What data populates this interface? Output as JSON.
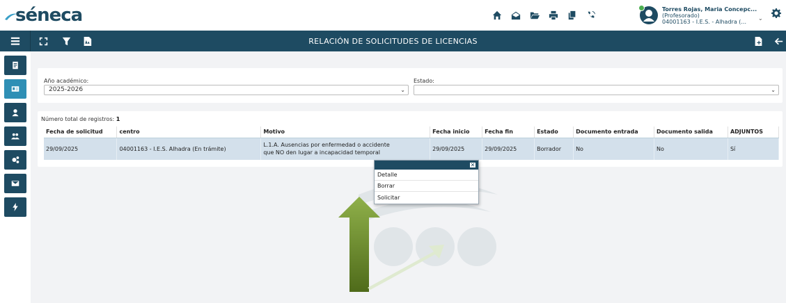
{
  "app": {
    "logo_text": "séneca",
    "page_title": "RELACIÓN DE SOLICITUDES DE LICENCIAS"
  },
  "user": {
    "name": "Torres Rojas, Maria Concepc...",
    "role": "(Profesorado)",
    "center": "04001163 - I.E.S. - Alhadra (..."
  },
  "filters": {
    "year_label": "Año académico:",
    "year_value": "2025-2026",
    "state_label": "Estado:",
    "state_value": ""
  },
  "results": {
    "total_label": "Número total de registros:",
    "total_value": "1",
    "columns": [
      "Fecha de solicitud",
      "centro",
      "Motivo",
      "Fecha inicio",
      "Fecha fin",
      "Estado",
      "Documento entrada",
      "Documento salida",
      "ADJUNTOS"
    ],
    "rows": [
      {
        "fecha_solicitud": "29/09/2025",
        "centro": "04001163 - I.E.S. Alhadra (En trámite)",
        "motivo_line1": "L.1.A. Ausencias por enfermedad o accidente",
        "motivo_line2": "que NO den lugar a incapacidad temporal",
        "fecha_inicio": "29/09/2025",
        "fecha_fin": "29/09/2025",
        "estado": "Borrador",
        "doc_entrada": "No",
        "doc_salida": "No",
        "adjuntos": "Sí"
      }
    ]
  },
  "context_menu": {
    "close_label": "✕",
    "items": [
      "Detalle",
      "Borrar",
      "Solicitar"
    ]
  },
  "colors": {
    "primary": "#1e4b62",
    "active_sidebar": "#2f8fb5",
    "row_selected": "#d3e0eb",
    "arrow_green": "#6b8e23"
  }
}
